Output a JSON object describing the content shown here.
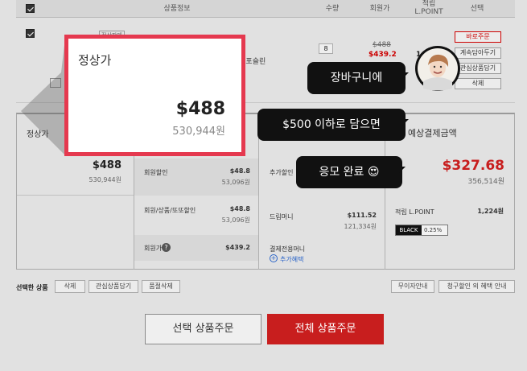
{
  "header": {
    "product_info": "상품정보",
    "quantity": "수량",
    "member_price": "회원가",
    "lpoint_top": "적립",
    "lpoint_bottom": "L.POINT",
    "select": "선택"
  },
  "product": {
    "tag": "정상판매",
    "name_fragment": "드릴 포슬린",
    "quantity": "8",
    "original_price": "$488",
    "member_price": "$439.2",
    "lpoint": "1",
    "buttons": {
      "buy_now": "바로주문",
      "save_for_later": "계속담아두기",
      "wishlist": "관심상품담기",
      "delete": "삭제"
    }
  },
  "popup": {
    "title": "정상가",
    "price": "$488",
    "price_krw": "530,944원"
  },
  "summary": {
    "regular_label": "정상가",
    "regular_price": "$488",
    "regular_krw": "530,944원",
    "member_discount_label": "회원할인",
    "member_discount_value": "$48.8",
    "member_discount_krw": "53,096원",
    "member_product_label": "회원/상품/또또할인",
    "member_product_value": "$48.8",
    "member_product_krw": "53,096원",
    "member_price_label": "회원가",
    "member_price_value": "$439.2",
    "extra_discount_label": "추가할인",
    "dream_money_label": "드림머니",
    "dream_money_value": "$111.52",
    "dream_money_krw": "121,334원",
    "payment_money_label": "결제전용머니",
    "extra_benefit": "추가혜택",
    "expected_label": "예상결제금액",
    "expected_price": "$327.68",
    "expected_krw": "356,514원",
    "lpoint_label": "적립 L.POINT",
    "lpoint_value": "1,224원",
    "black_label": "BLACK",
    "black_rate": "0.25%"
  },
  "bottom_bar": {
    "selected_label": "선택한 상품",
    "delete": "삭제",
    "wishlist": "관심상품담기",
    "soldout_delete": "품절삭제",
    "interest_free": "무이자안내",
    "billing_discount": "청구할인 외 혜택 안내"
  },
  "orders": {
    "selected": "선택 상품주문",
    "all": "전체 상품주문"
  },
  "chat": {
    "line1": "장바구니에",
    "line2": "$500 이하로 담으면",
    "line3": "응모 완료",
    "emoji": "😍"
  },
  "colors": {
    "accent_red": "#c81e1e",
    "popup_border": "#e5394f",
    "bubble": "#111111"
  }
}
